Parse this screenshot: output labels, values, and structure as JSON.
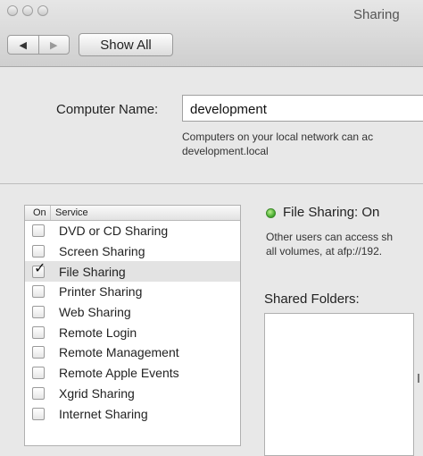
{
  "window": {
    "title": "Sharing"
  },
  "toolbar": {
    "back_icon": "◀",
    "forward_icon": "▶",
    "show_all_label": "Show All"
  },
  "computer_name": {
    "label": "Computer Name:",
    "value": "development",
    "description": "Computers on your local network can ac\ndevelopment.local"
  },
  "services": {
    "header_on": "On",
    "header_service": "Service",
    "items": [
      {
        "label": "DVD or CD Sharing",
        "on": false,
        "selected": false
      },
      {
        "label": "Screen Sharing",
        "on": false,
        "selected": false
      },
      {
        "label": "File Sharing",
        "on": true,
        "selected": true
      },
      {
        "label": "Printer Sharing",
        "on": false,
        "selected": false
      },
      {
        "label": "Web Sharing",
        "on": false,
        "selected": false
      },
      {
        "label": "Remote Login",
        "on": false,
        "selected": false
      },
      {
        "label": "Remote Management",
        "on": false,
        "selected": false
      },
      {
        "label": "Remote Apple Events",
        "on": false,
        "selected": false
      },
      {
        "label": "Xgrid Sharing",
        "on": false,
        "selected": false
      },
      {
        "label": "Internet Sharing",
        "on": false,
        "selected": false
      }
    ]
  },
  "detail": {
    "status": "File Sharing: On",
    "status_color": "#3fa52a",
    "description": "Other users can access sh\nall volumes, at afp://192.",
    "shared_folders_label": "Shared Folders:"
  }
}
